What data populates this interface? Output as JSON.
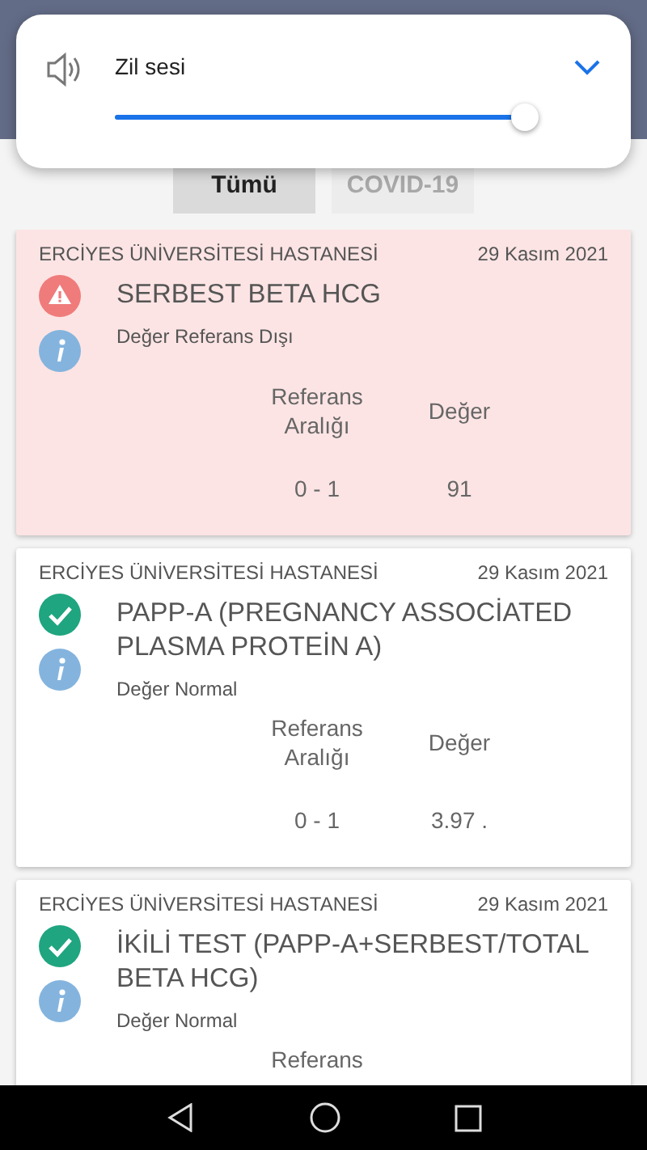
{
  "volume_popup": {
    "label": "Zil sesi",
    "level": 0.97
  },
  "tabs": [
    {
      "label": "Tümü",
      "selected": true
    },
    {
      "label": "COVID-19",
      "selected": false
    }
  ],
  "results": [
    {
      "hospital": "ERCİYES ÜNİVERSİTESİ HASTANESİ",
      "date": "29 Kasım 2021",
      "kind": "warning",
      "title": "SERBEST BETA HCG",
      "note": "Değer Referans Dışı",
      "ref_header": "Referans Aralığı",
      "value_header": "Değer",
      "ref": "0 - 1",
      "value": "91"
    },
    {
      "hospital": "ERCİYES ÜNİVERSİTESİ HASTANESİ",
      "date": "29 Kasım 2021",
      "kind": "normal",
      "title": "PAPP-A (PREGNANCY ASSOCİATED PLASMA PROTEİN A)",
      "note": "Değer Normal",
      "ref_header": "Referans Aralığı",
      "value_header": "Değer",
      "ref": "0 - 1",
      "value": "3.97  ."
    },
    {
      "hospital": "ERCİYES ÜNİVERSİTESİ HASTANESİ",
      "date": "29 Kasım 2021",
      "kind": "normal",
      "title": "İKİLİ TEST (PAPP-A+SERBEST/TOTAL BETA HCG)",
      "note": "Değer Normal",
      "ref_header": "Referans"
    }
  ]
}
